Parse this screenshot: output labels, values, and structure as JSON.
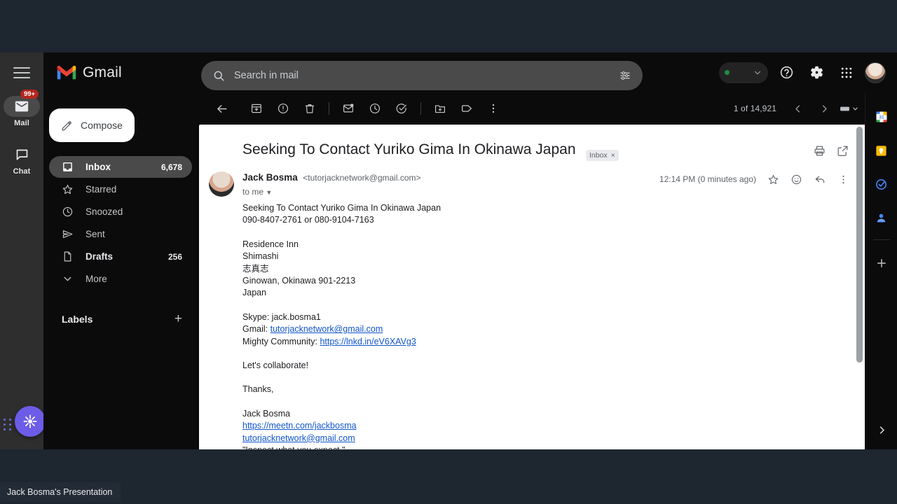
{
  "app": {
    "brand": "Gmail",
    "caption": "Jack Bosma's Presentation"
  },
  "rail": {
    "hamburger_name": "Main menu",
    "items": [
      {
        "label": "Mail",
        "badge": "99+",
        "icon": "mail-icon",
        "active": true
      },
      {
        "label": "Chat",
        "badge": "",
        "icon": "chat-icon",
        "active": false
      }
    ]
  },
  "search": {
    "placeholder": "Search in mail",
    "value": "",
    "filter_icon": "search-options-icon",
    "search_icon": "search-icon"
  },
  "header": {
    "status_icon": "status-green-dot",
    "status_caret": "chevron-down-icon",
    "support_label": "Support",
    "settings_label": "Settings",
    "apps_label": "Google apps",
    "account_label": "Google Account"
  },
  "nav": {
    "compose_label": "Compose",
    "items": [
      {
        "label": "Inbox",
        "count": "6,678",
        "icon": "inbox-icon",
        "active": true,
        "bold": true
      },
      {
        "label": "Starred",
        "count": "",
        "icon": "star-icon",
        "active": false,
        "bold": false
      },
      {
        "label": "Snoozed",
        "count": "",
        "icon": "clock-icon",
        "active": false,
        "bold": false
      },
      {
        "label": "Sent",
        "count": "",
        "icon": "send-icon",
        "active": false,
        "bold": false
      },
      {
        "label": "Drafts",
        "count": "256",
        "icon": "draft-icon",
        "active": false,
        "bold": true
      },
      {
        "label": "More",
        "count": "",
        "icon": "chevron-down-icon",
        "active": false,
        "bold": false
      }
    ],
    "labels_title": "Labels",
    "labels_add": "+"
  },
  "toolbar": {
    "back_label": "Back to Inbox",
    "archive_label": "Archive",
    "spam_label": "Report spam",
    "delete_label": "Delete",
    "unread_label": "Mark as unread",
    "snooze_label": "Snooze",
    "tasks_label": "Add to tasks",
    "move_label": "Move to",
    "labels_label": "Labels",
    "more_label": "More",
    "page_count": "1 of 14,921",
    "prev_label": "Older",
    "next_label": "Newer",
    "input_tools_label": "Input tools"
  },
  "email": {
    "subject": "Seeking To Contact Yuriko Gima In Okinawa Japan",
    "label_chip": "Inbox",
    "label_chip_close": "×",
    "print_label": "Print all",
    "popout_label": "Open in new window",
    "sender_name": "Jack Bosma",
    "sender_email": "<tutorjacknetwork@gmail.com>",
    "recipients": "to me",
    "timestamp": "12:14 PM (0 minutes ago)",
    "star_label": "Star",
    "emoji_label": "Add emoji reaction",
    "reply_label": "Reply",
    "more_label": "More",
    "body_lines": [
      {
        "text": "Seeking To Contact Yuriko Gima In Okinawa Japan",
        "link": false
      },
      {
        "text": "090-8407-2761 or 080-9104-7163",
        "link": false
      },
      {
        "text": "",
        "link": false
      },
      {
        "text": "Residence Inn",
        "link": false
      },
      {
        "text": "Shimashi",
        "link": false
      },
      {
        "text": "志真志",
        "link": false
      },
      {
        "text": "Ginowan, Okinawa 901-2213",
        "link": false
      },
      {
        "text": "Japan",
        "link": false
      },
      {
        "text": "",
        "link": false
      },
      {
        "text": "Skype: jack.bosma1",
        "link": false
      },
      {
        "prefix": "Gmail: ",
        "text": "tutorjacknetwork@gmail.com",
        "link": true
      },
      {
        "prefix": "Mighty Community: ",
        "text": "https://lnkd.in/eV6XAVg3",
        "link": true
      },
      {
        "text": "",
        "link": false
      },
      {
        "text": "Let's collaborate!",
        "link": false
      },
      {
        "text": "",
        "link": false
      },
      {
        "text": "Thanks,",
        "link": false
      },
      {
        "text": "",
        "link": false
      },
      {
        "text": "Jack Bosma",
        "link": false
      },
      {
        "text": "https://meetn.com/jackbosma",
        "link": true
      },
      {
        "text": "tutorjacknetwork@gmail.com",
        "link": true
      },
      {
        "text": "\"Inspect what you expect.\"",
        "link": false
      }
    ]
  },
  "side_panel": {
    "items": [
      {
        "name": "calendar-icon",
        "label": "Calendar"
      },
      {
        "name": "keep-icon",
        "label": "Keep"
      },
      {
        "name": "tasks-icon",
        "label": "Tasks"
      },
      {
        "name": "contacts-icon",
        "label": "Contacts"
      }
    ],
    "add_label": "+",
    "expand_label": "Show side panel"
  },
  "colors": {
    "accent_purple": "#6c5ce7",
    "badge_red": "#b3261e",
    "link_blue": "#1155cc",
    "status_green": "#1e8e3e",
    "page_bg": "#1e2630"
  }
}
